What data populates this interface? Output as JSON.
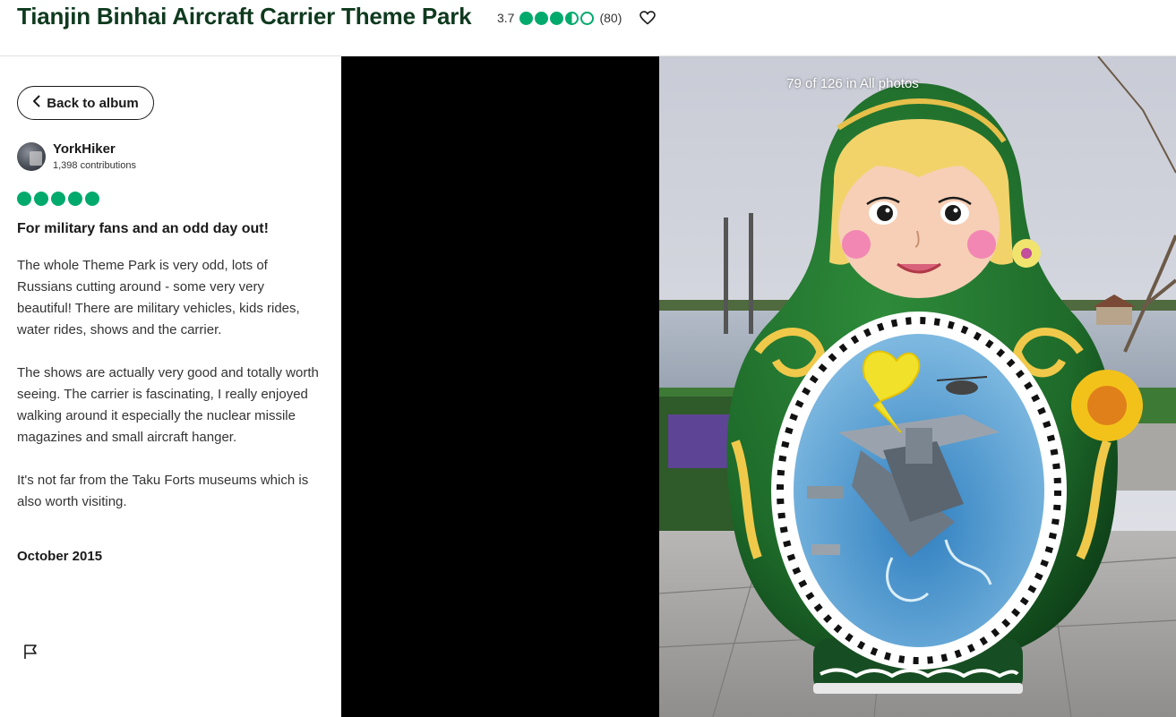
{
  "header": {
    "title": "Tianjin Binhai Aircraft Carrier Theme Park",
    "rating_value": "3.7",
    "review_count": "(80)",
    "rating_bubbles": 3.5,
    "favorite_icon": "heart-icon"
  },
  "left_panel": {
    "back_button_label": "Back to album",
    "back_icon": "chevron-left-icon",
    "reviewer": {
      "name": "YorkHiker",
      "contributions": "1,398 contributions"
    },
    "review": {
      "bubbles": 5,
      "title": "For military fans and an odd day out!",
      "paragraphs": [
        "The whole Theme Park is very odd, lots of Russians cutting around - some very very beautiful! There are military vehicles, kids rides, water rides, shows and the carrier.",
        "The shows are actually very good and totally worth seeing. The carrier is fascinating, I really enjoyed walking around it especially the nuclear missile magazines and small aircraft hanger.",
        "It's not far from the Taku Forts museums which is also worth visiting."
      ],
      "date": "October 2015"
    },
    "report_icon": "flag-icon"
  },
  "viewer": {
    "counter": "79 of 126 in All photos"
  },
  "colors": {
    "brand_green": "#00aa6c",
    "title_green": "#0f3a1f"
  }
}
